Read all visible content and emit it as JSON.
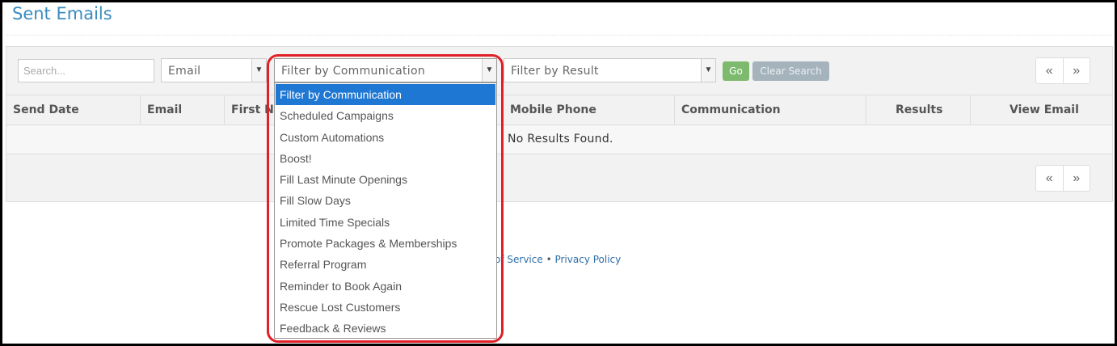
{
  "page": {
    "title": "Sent Emails"
  },
  "filters": {
    "search_placeholder": "Search...",
    "email_select": "Email",
    "communication_select": "Filter by Communication",
    "result_select": "Filter by Result",
    "go_label": "Go",
    "clear_label": "Clear Search"
  },
  "pager": {
    "prev": "«",
    "next": "»"
  },
  "table": {
    "columns": [
      "Send Date",
      "Email",
      "First Na",
      "Mobile Phone",
      "Communication",
      "Results",
      "View Email"
    ],
    "empty_message": "No Results Found."
  },
  "footer": {
    "terms_label": "of Service",
    "separator": "•",
    "privacy_label": "Privacy Policy"
  },
  "dropdown": {
    "selected_index": 0,
    "options": [
      "Filter by Communication",
      "Scheduled Campaigns",
      "Custom Automations",
      "Boost!",
      "Fill Last Minute Openings",
      "Fill Slow Days",
      "Limited Time Specials",
      "Promote Packages & Memberships",
      "Referral Program",
      "Reminder to Book Again",
      "Rescue Lost Customers",
      "Feedback & Reviews"
    ]
  },
  "colors": {
    "title": "#3a8bbf",
    "go_button": "#7dba6e",
    "clear_button": "#a5b3bd",
    "selected_option": "#1e77d3",
    "highlight_outline": "#e11f26",
    "link": "#2d6ea8"
  },
  "icons": {
    "select_arrow": "chevron-down-icon",
    "prev_page": "double-chevron-left-icon",
    "next_page": "double-chevron-right-icon"
  }
}
